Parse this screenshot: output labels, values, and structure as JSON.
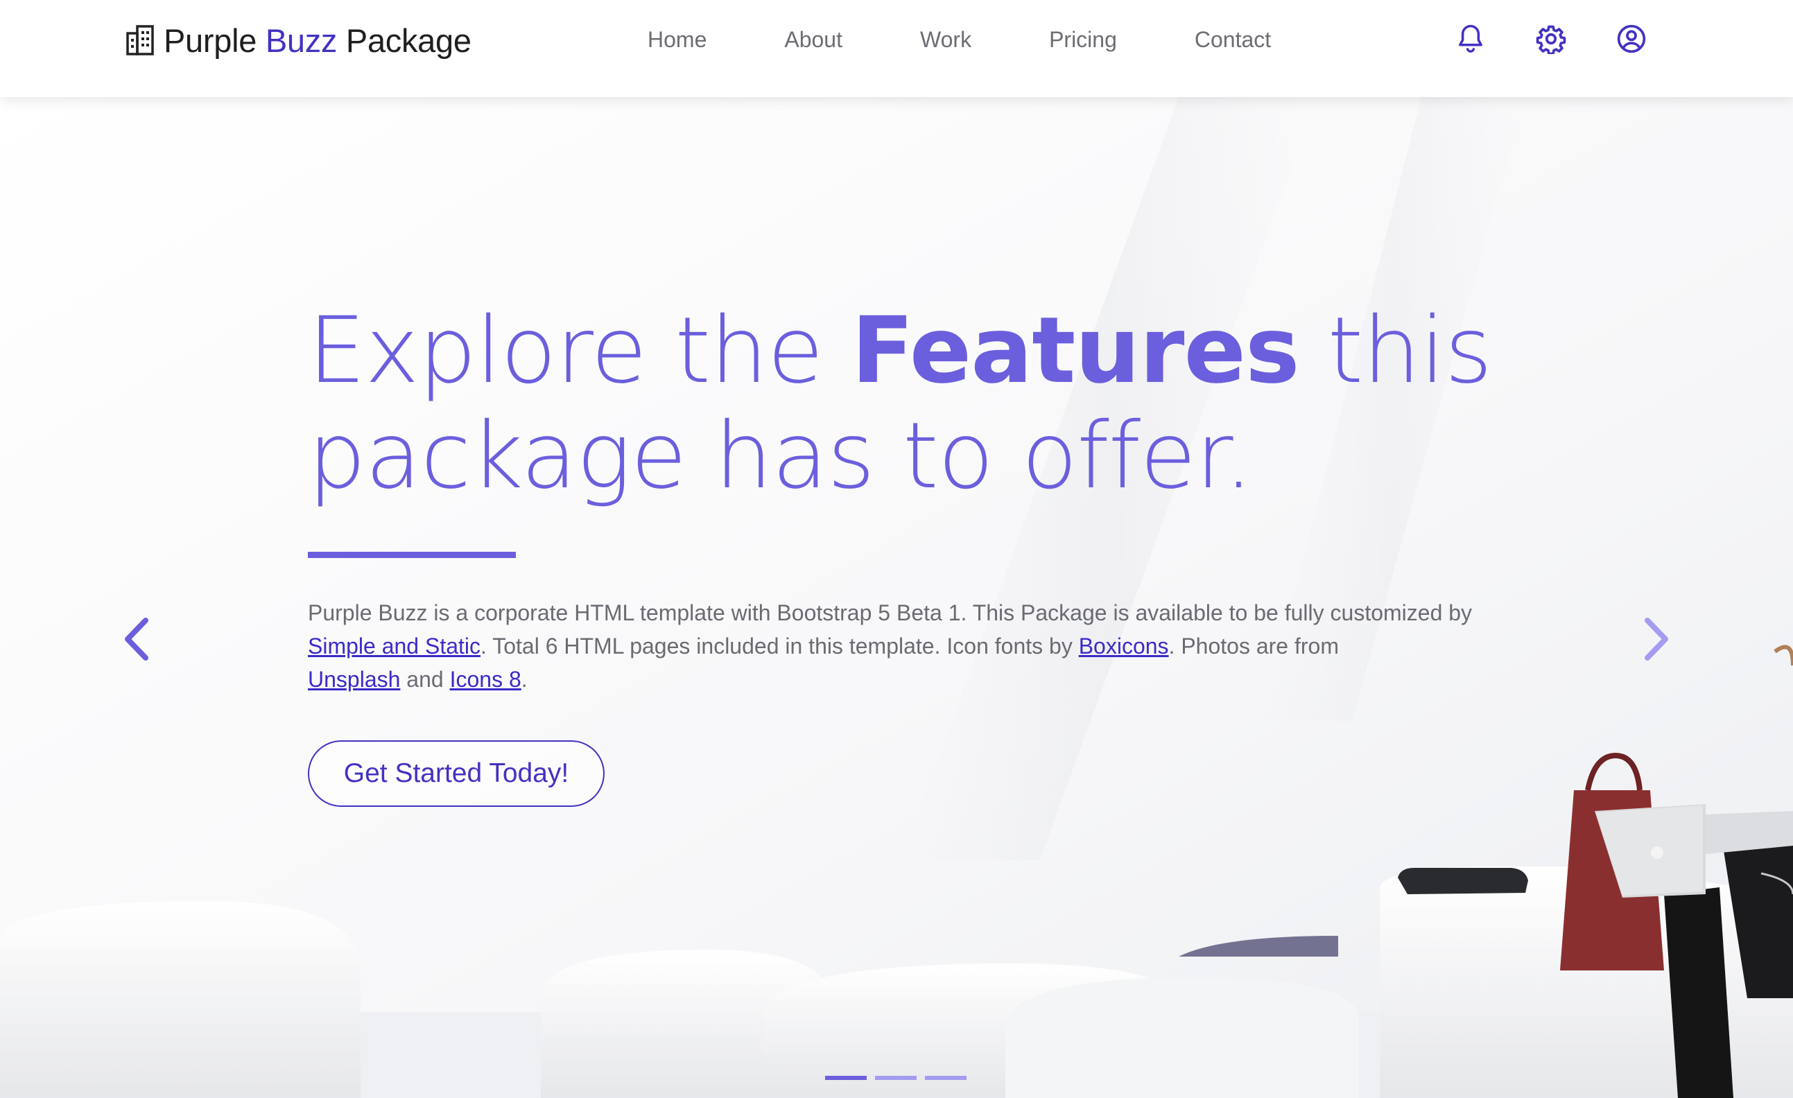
{
  "navbar": {
    "brand": {
      "part1": "Purple",
      "part2": "Buzz",
      "part3": "Package",
      "icon": "building-icon"
    },
    "links": [
      "Home",
      "About",
      "Work",
      "Pricing",
      "Contact"
    ],
    "icons": [
      "bell-icon",
      "gear-icon",
      "user-circle-icon"
    ]
  },
  "hero": {
    "title": {
      "pre": "Explore the ",
      "strong": "Features",
      "post": " this",
      "line2": "package has to offer."
    },
    "description": {
      "t1": "Purple Buzz is a corporate HTML template with Bootstrap 5 Beta 1. This Package is available to be fully customized by ",
      "link1": "Simple and Static",
      "t2": ". Total 6 HTML pages included in this template. Icon fonts by ",
      "link2": "Boxicons",
      "t3": ". Photos are from ",
      "link3": "Unsplash",
      "t4": " and ",
      "link4": "Icons 8",
      "t5": "."
    },
    "cta_label": "Get Started Today!",
    "prev_icon": "chevron-left-icon",
    "next_icon": "chevron-right-icon",
    "slides": {
      "count": 3,
      "active": 1
    }
  },
  "colors": {
    "accent": "#6b5fdd",
    "brand": "#4232c2",
    "text": "#6a6a72"
  }
}
